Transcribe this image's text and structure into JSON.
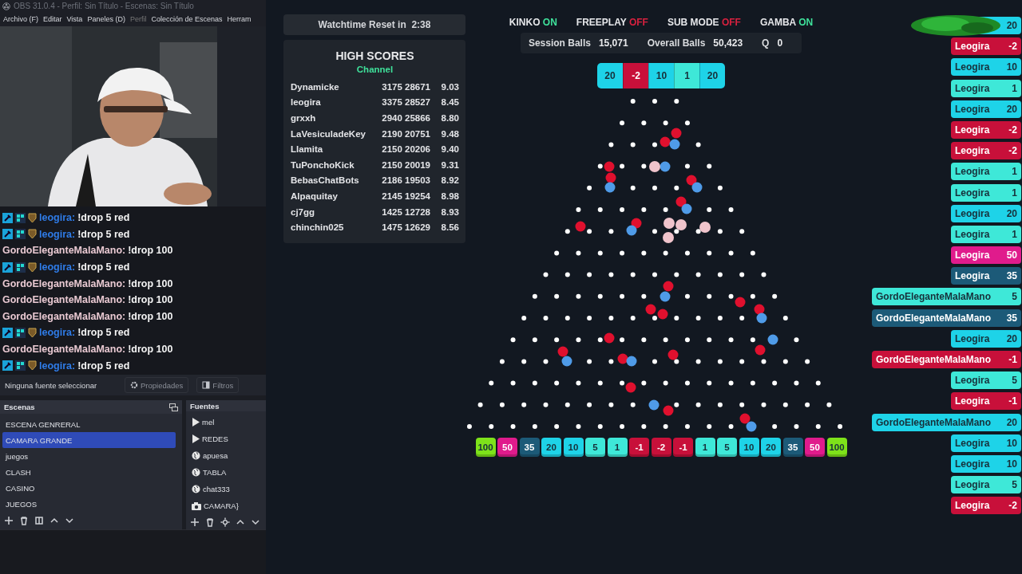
{
  "window": {
    "title": "OBS 31.0.4 - Perfil: Sin Título - Escenas: Sin Título"
  },
  "menu": [
    "Archivo (F)",
    "Editar",
    "Vista",
    "Paneles (D)",
    "Perfil",
    "Colección de Escenas",
    "Herram"
  ],
  "chat": [
    {
      "kind": "badged",
      "user": "leogira:",
      "message": "!drop 5 red"
    },
    {
      "kind": "badged",
      "user": "leogira:",
      "message": "!drop 5 red"
    },
    {
      "kind": "plain",
      "user": "GordoEleganteMalaMano:",
      "message": "!drop 100"
    },
    {
      "kind": "badged",
      "user": "leogira:",
      "message": "!drop 5 red"
    },
    {
      "kind": "plain",
      "user": "GordoEleganteMalaMano:",
      "message": "!drop 100"
    },
    {
      "kind": "plain",
      "user": "GordoEleganteMalaMano:",
      "message": "!drop 100"
    },
    {
      "kind": "plain",
      "user": "GordoEleganteMalaMano:",
      "message": "!drop 100"
    },
    {
      "kind": "badged",
      "user": "leogira:",
      "message": "!drop 5 red"
    },
    {
      "kind": "plain",
      "user": "GordoEleganteMalaMano:",
      "message": "!drop 100"
    },
    {
      "kind": "badged",
      "user": "leogira:",
      "message": "!drop 5 red"
    }
  ],
  "source_bar": {
    "status": "Ninguna fuente seleccionar",
    "buttons": [
      "Propiedades",
      "Filtros"
    ]
  },
  "scenes": {
    "title": "Escenas",
    "items": [
      {
        "label": "ESCENA GENRERAL",
        "selected": false
      },
      {
        "label": "CAMARA GRANDE",
        "selected": true
      },
      {
        "label": "juegos",
        "selected": false
      },
      {
        "label": "CLASH",
        "selected": false
      },
      {
        "label": "CASINO",
        "selected": false
      },
      {
        "label": "JUEGOS",
        "selected": false
      }
    ]
  },
  "sources": {
    "title": "Fuentes",
    "items": [
      {
        "kind": "media",
        "label": "mel"
      },
      {
        "kind": "media",
        "label": "REDES"
      },
      {
        "kind": "browser",
        "label": "apuesa"
      },
      {
        "kind": "browser",
        "label": "TABLA"
      },
      {
        "kind": "browser",
        "label": "chat333"
      },
      {
        "kind": "camera",
        "label": "CAMARA}"
      }
    ]
  },
  "watchtime": "Watchtime Reset in  2:38",
  "high_scores": {
    "title": "HIGH SCORES",
    "subtitle": "Channel",
    "rows": [
      [
        "Dynamicke",
        "3175 28671",
        "9.03"
      ],
      [
        "leogira",
        "3375 28527",
        "8.45"
      ],
      [
        "grxxh",
        "2940 25866",
        "8.80"
      ],
      [
        "LaVesiculadeKey",
        "2190 20751",
        "9.48"
      ],
      [
        "Llamita",
        "2150 20206",
        "9.40"
      ],
      [
        "TuPonchoKick",
        "2150 20019",
        "9.31"
      ],
      [
        "BebasChatBots",
        "2186 19503",
        "8.92"
      ],
      [
        "Alpaquitay",
        "2145 19254",
        "8.98"
      ],
      [
        "cj7gg",
        "1425 12728",
        "8.93"
      ],
      [
        "chinchin025",
        "1475 12629",
        "8.56"
      ]
    ]
  },
  "modes": [
    {
      "label": "KINKO",
      "value": "ON",
      "on": true
    },
    {
      "label": "FREEPLAY",
      "value": "OFF",
      "on": false
    },
    {
      "label": "SUB MODE",
      "value": "OFF",
      "on": false
    },
    {
      "label": "GAMBA",
      "value": "ON",
      "on": true
    }
  ],
  "stats": [
    {
      "label": "Session Balls",
      "value": "15,071"
    },
    {
      "label": "Overall Balls",
      "value": "50,423"
    },
    {
      "label": "Q",
      "value": "0"
    }
  ],
  "recent": [
    {
      "value": "20",
      "color": "#1ed3e8"
    },
    {
      "value": "-2",
      "color": "#c8103a"
    },
    {
      "value": "10",
      "color": "#1ed3e8"
    },
    {
      "value": "1",
      "color": "#3ee8d8"
    },
    {
      "value": "20",
      "color": "#1ed3e8"
    }
  ],
  "bins": [
    {
      "value": "100",
      "color": "#7ee21a"
    },
    {
      "value": "50",
      "color": "#e01b8c"
    },
    {
      "value": "35",
      "color": "#1c5a78"
    },
    {
      "value": "20",
      "color": "#1ed3e8"
    },
    {
      "value": "10",
      "color": "#1ed3e8"
    },
    {
      "value": "5",
      "color": "#3ee8d8"
    },
    {
      "value": "1",
      "color": "#3ee8d8"
    },
    {
      "value": "-1",
      "color": "#c8103a"
    },
    {
      "value": "-2",
      "color": "#c8103a"
    },
    {
      "value": "-1",
      "color": "#c8103a"
    },
    {
      "value": "1",
      "color": "#3ee8d8"
    },
    {
      "value": "5",
      "color": "#3ee8d8"
    },
    {
      "value": "10",
      "color": "#1ed3e8"
    },
    {
      "value": "20",
      "color": "#1ed3e8"
    },
    {
      "value": "35",
      "color": "#1c5a78"
    },
    {
      "value": "50",
      "color": "#e01b8c"
    },
    {
      "value": "100",
      "color": "#7ee21a"
    }
  ],
  "feed": [
    {
      "value": "20",
      "color": "#1ed3e8"
    },
    {
      "name": "Leogira",
      "value": "-2",
      "color": "#c8103a"
    },
    {
      "name": "Leogira",
      "value": "10",
      "color": "#1ed3e8"
    },
    {
      "name": "Leogira",
      "value": "1",
      "color": "#3ee8d8"
    },
    {
      "name": "Leogira",
      "value": "20",
      "color": "#1ed3e8"
    },
    {
      "name": "Leogira",
      "value": "-2",
      "color": "#c8103a"
    },
    {
      "name": "Leogira",
      "value": "-2",
      "color": "#c8103a"
    },
    {
      "name": "Leogira",
      "value": "1",
      "color": "#3ee8d8"
    },
    {
      "name": "Leogira",
      "value": "1",
      "color": "#3ee8d8"
    },
    {
      "name": "Leogira",
      "value": "20",
      "color": "#1ed3e8"
    },
    {
      "name": "Leogira",
      "value": "1",
      "color": "#3ee8d8"
    },
    {
      "name": "Leogira",
      "value": "50",
      "color": "#e01b8c"
    },
    {
      "name": "Leogira",
      "value": "35",
      "color": "#1c5a78"
    },
    {
      "name": "GordoEleganteMalaMano",
      "value": "5",
      "color": "#3ee8d8"
    },
    {
      "name": "GordoEleganteMalaMano",
      "value": "35",
      "color": "#1c5a78"
    },
    {
      "name": "Leogira",
      "value": "20",
      "color": "#1ed3e8"
    },
    {
      "name": "GordoEleganteMalaMano",
      "value": "-1",
      "color": "#c8103a"
    },
    {
      "name": "Leogira",
      "value": "5",
      "color": "#3ee8d8"
    },
    {
      "name": "Leogira",
      "value": "-1",
      "color": "#c8103a"
    },
    {
      "name": "GordoEleganteMalaMano",
      "value": "20",
      "color": "#1ed3e8"
    },
    {
      "name": "Leogira",
      "value": "10",
      "color": "#1ed3e8"
    },
    {
      "name": "Leogira",
      "value": "10",
      "color": "#1ed3e8"
    },
    {
      "name": "Leogira",
      "value": "5",
      "color": "#3ee8d8"
    },
    {
      "name": "Leogira",
      "value": "-2",
      "color": "#c8103a"
    }
  ]
}
